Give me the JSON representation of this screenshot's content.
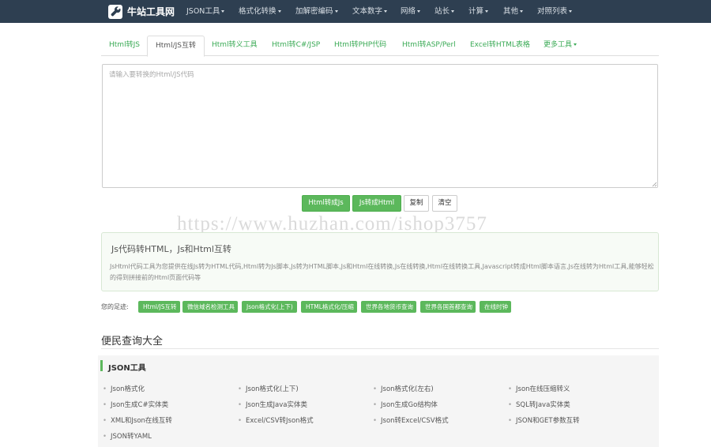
{
  "navbar": {
    "brand": "牛站工具网",
    "items": [
      {
        "label": "JSON工具",
        "dropdown": true
      },
      {
        "label": "格式化转换",
        "dropdown": true
      },
      {
        "label": "加解密编码",
        "dropdown": true
      },
      {
        "label": "文本数字",
        "dropdown": true
      },
      {
        "label": "网络",
        "dropdown": true
      },
      {
        "label": "站长",
        "dropdown": true
      },
      {
        "label": "计算",
        "dropdown": true
      },
      {
        "label": "其他",
        "dropdown": true
      },
      {
        "label": "对照列表",
        "dropdown": true
      }
    ]
  },
  "tabs": [
    {
      "label": "Html转JS",
      "active": false
    },
    {
      "label": "Html/JS互转",
      "active": true
    },
    {
      "label": "Html转义工具",
      "active": false
    },
    {
      "label": "Html转C#/JSP",
      "active": false
    },
    {
      "label": "Html转PHP代码",
      "active": false
    },
    {
      "label": "Html转ASP/Perl",
      "active": false
    },
    {
      "label": "Excel转HTML表格",
      "active": false
    },
    {
      "label": "更多工具",
      "active": false,
      "dropdown": true
    }
  ],
  "editor": {
    "placeholder": "请输入要转换的Html/JS代码",
    "value": ""
  },
  "buttons": {
    "html_to_js": "Html转成Js",
    "js_to_html": "Js转成Html",
    "copy": "复制",
    "clear": "清空"
  },
  "watermark": "https://www.huzhan.com/ishop3757",
  "info": {
    "title": "Js代码转HTML，Js和Html互转",
    "description": "JsHtml代码工具为您提供在线Js转为HTML代码,Html转为Js脚本,Js转为HTML脚本,Js和Html在线转换,Js在线转换,Html在线转换工具,Javascript转成Html脚本语言,Js在线转为Html工具,能够轻松的得到拼接前的Html页面代码等"
  },
  "footprints": {
    "label": "您的足迹:",
    "tags": [
      "Html/JS互转",
      "微信域名检测工具",
      "Json格式化(上下)",
      "HTML格式化/压缩",
      "世界各地货币查询",
      "世界各国首都查询",
      "在线时钟"
    ]
  },
  "section": {
    "title": "便民查询大全",
    "category": "JSON工具",
    "tools": [
      "Json格式化",
      "Json格式化(上下)",
      "Json格式化(左右)",
      "Json在线压缩转义",
      "Json生成C#实体类",
      "Json生成Java实体类",
      "Json生成Go结构体",
      "SQL转Java实体类",
      "XML和Json在线互转",
      "Excel/CSV转Json格式",
      "Json转Excel/CSV格式",
      "JSON和GET参数互转",
      "JSON转YAML"
    ]
  },
  "colors": {
    "navbar_bg": "#2e3f51",
    "accent_green": "#5cb85c",
    "tab_link": "#3aaa55"
  }
}
